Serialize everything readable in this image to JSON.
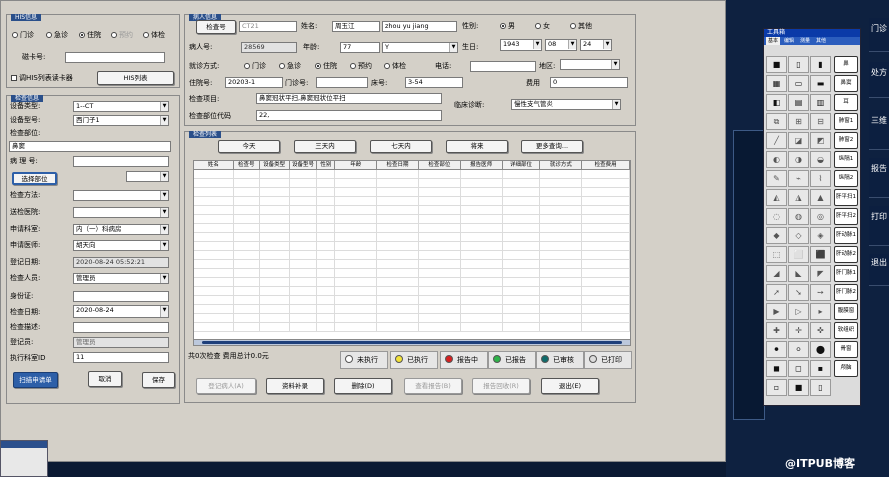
{
  "his": {
    "title": "HIS信息",
    "radios": [
      "门诊",
      "急诊",
      "住院",
      "预约",
      "体检"
    ],
    "selected_radio": "住院",
    "card_label": "磁卡号:",
    "card_value": "",
    "read_check_label": "调HIS列表读卡器",
    "his_list_button": "HIS列表"
  },
  "exam": {
    "title": "检查信息",
    "device_type_label": "设备类型:",
    "device_type_value": "1--CT",
    "device_model_label": "设备型号:",
    "device_model_value": "西门子1",
    "part_label": "检查部位:",
    "part_value": "鼻窦",
    "pathology_label": "病 理 号:",
    "pathology_value": "",
    "choose_part_button": "选择部位",
    "method_label": "检查方法:",
    "method_value": "",
    "hospital_label": "送检医院:",
    "hospital_value": "",
    "dept_label": "申请科室:",
    "dept_value": "内（一）科病房",
    "doctor_label": "申请医师:",
    "doctor_value": "胡天向",
    "reg_date_label": "登记日期:",
    "reg_date_value": "2020-08-24 05:52:21",
    "staff_label": "检查人员:",
    "staff_value": "管理员",
    "idcard_label": "身份证:",
    "idcard_value": "",
    "exam_date_label": "检查日期:",
    "exam_date_value": "2020-08-24",
    "desc_label": "检查描述:",
    "desc_value": "",
    "registrar_label": "登记员:",
    "registrar_value": "管理员",
    "exec_room_label": "执行科室ID",
    "exec_room_value": "11",
    "scan_button": "扫描申请单",
    "cancel_button": "取消",
    "save_button": "保存"
  },
  "patient": {
    "title": "病人信息",
    "check_no_button": "检查号",
    "check_no_value": "CT21",
    "name_label": "姓名:",
    "name_value": "周玉江",
    "pinyin_value": "zhou yu jiang",
    "gender_label": "性别:",
    "genders": [
      "男",
      "女",
      "其他"
    ],
    "gender_selected": "男",
    "patient_id_label": "病人号:",
    "patient_id_value": "28569",
    "age_label": "年龄:",
    "age_value": "77",
    "age_unit": "Y",
    "birth_label": "生日:",
    "birth_year": "1943",
    "birth_month": "08",
    "birth_day": "24",
    "visit_label": "就诊方式:",
    "visit_types": [
      "门诊",
      "急诊",
      "住院",
      "预约",
      "体检"
    ],
    "visit_selected": "住院",
    "phone_label": "电话:",
    "phone_value": "",
    "region_label": "地区:",
    "region_value": "",
    "inpatient_label": "住院号:",
    "inpatient_value": "20203-1",
    "outpatient_label": "门诊号:",
    "outpatient_value": "",
    "bed_label": "床号:",
    "bed_value": "3-54",
    "fee_label": "费用",
    "fee_value": "0",
    "items_label": "检查项目:",
    "items_value": "鼻窦冠状平扫,鼻窦冠状位平扫",
    "diagnosis_label": "临床诊断:",
    "diagnosis_value": "慢性支气管炎",
    "part_code_label": "检查部位代码",
    "part_code_value": "22,"
  },
  "list": {
    "title": "检查列表",
    "filter_buttons": [
      "今天",
      "三天内",
      "七天内",
      "将来",
      "更多查询..."
    ],
    "columns": [
      "姓名",
      "检查号",
      "设备类型",
      "设备型号",
      "性别",
      "年龄",
      "检查日期",
      "检查部位",
      "报告医师",
      "详细部位",
      "就诊方式",
      "检查费用"
    ],
    "summary": "共0次检查  费用总计0.0元",
    "statuses": [
      {
        "label": "未执行",
        "color": "#ffffff"
      },
      {
        "label": "已执行",
        "color": "#f2e23a"
      },
      {
        "label": "报告中",
        "color": "#d62020"
      },
      {
        "label": "已报告",
        "color": "#2fb34a"
      },
      {
        "label": "已审核",
        "color": "#0e6b6b"
      },
      {
        "label": "已打印",
        "color": "#dcdcdc"
      }
    ],
    "bottom_buttons": [
      {
        "label": "登记病人(A)",
        "enabled": false
      },
      {
        "label": "资料补录",
        "enabled": true
      },
      {
        "label": "删除(D)",
        "enabled": true
      },
      {
        "label": "查看报告(B)",
        "enabled": false
      },
      {
        "label": "报告回收(R)",
        "enabled": false
      },
      {
        "label": "退出(E)",
        "enabled": true
      }
    ]
  },
  "toolbox": {
    "title": "工具箱",
    "tabs": [
      "基本",
      "编辑",
      "测量",
      "其他"
    ],
    "buttons": [
      "鼻",
      "鼻窦",
      "耳",
      "肺窗1",
      "肺窗2",
      "纵隔1",
      "纵隔2",
      "肝平扫1",
      "肝平扫2",
      "肝动脉1",
      "肝动脉2",
      "肝门脉1",
      "肝门脉2",
      "腹膜窗",
      "软组织",
      "骨窗",
      "颅脑"
    ]
  },
  "right_menu": [
    "门诊",
    "处方",
    "三维",
    "报告",
    "打印",
    "退出"
  ],
  "watermark": "@ITPUB博客"
}
